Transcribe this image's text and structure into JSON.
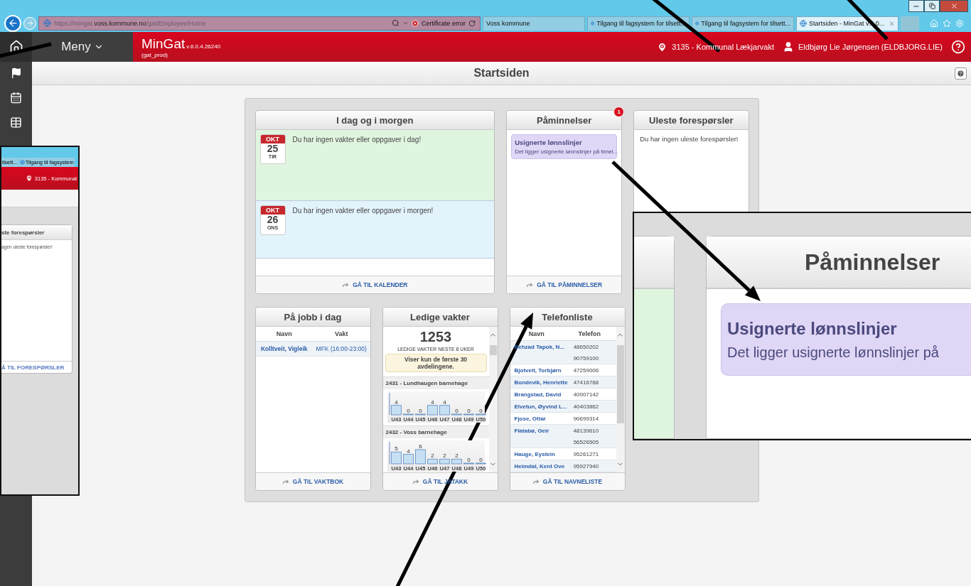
{
  "browser": {
    "address": [
      {
        "text": "https://mingat.",
        "highlighted": false
      },
      {
        "text": "voss.kommune.no",
        "highlighted": true
      },
      {
        "text": "/gat/Employee/Home",
        "highlighted": false
      }
    ],
    "certificate_error": "Certificate error",
    "tabs": [
      {
        "label": "Voss kommune",
        "selected": false,
        "icon": false
      },
      {
        "label": "Tilgang til fagsystem for tilsett...",
        "selected": false,
        "icon": true
      },
      {
        "label": "Tilgang til fagsystem for tilsett...",
        "selected": false,
        "icon": true
      },
      {
        "label": "Startsiden - MinGat v.6.0...",
        "selected": true,
        "icon": true
      }
    ]
  },
  "app_header": {
    "menu": "Meny",
    "product": "MinGat",
    "version": "v.6.0.4.26240",
    "environment": "(gat_prod)",
    "location": "3135 - Kommunal Lækjarvakt",
    "user": "Eldbjørg Lie Jørgensen (ELDBJORG.LIE)"
  },
  "page_title": "Startsiden",
  "today_tomorrow": {
    "title": "I dag og i morgen",
    "days": [
      {
        "month": "OKT",
        "day": "25",
        "weekday": "TIR",
        "message": "Du har ingen vakter eller oppgaver i dag!",
        "color": "#e0f5df"
      },
      {
        "month": "OKT",
        "day": "26",
        "weekday": "ONS",
        "message": "Du har ingen vakter eller oppgaver i morgen!",
        "color": "#e2f3fb"
      }
    ],
    "link": "GÅ TIL KALENDER"
  },
  "reminders": {
    "title": "Påminnelser",
    "badge": "1",
    "items": [
      {
        "title": "Usignerte lønnslinjer",
        "text": "Det ligger usignerte lønnslinjer på timel..."
      }
    ],
    "link": "GÅ TIL PÅMINNELSER"
  },
  "unread_requests": {
    "title": "Uleste forespørsler",
    "message": "Du har ingen uleste forespørsler!"
  },
  "at_work_today": {
    "title": "På jobb i dag",
    "columns": [
      "Navn",
      "Vakt"
    ],
    "rows": [
      {
        "name": "Kolltveit, Vigleik",
        "shift": "MFK (16:00-23:00)"
      }
    ],
    "link": "GÅ TIL VAKTBOK"
  },
  "free_shifts": {
    "title": "Ledige vakter",
    "count": "1253",
    "count_label": "LEDIGE VAKTER NESTE 8 UKER",
    "notice": "Viser kun de første 30 avdelingene.",
    "departments": [
      {
        "name": "2431 - Lundhaugen barnehage",
        "chart_data": {
          "type": "bar",
          "categories": [
            "U43",
            "U44",
            "U45",
            "U46",
            "U47",
            "U48",
            "U49",
            "U50"
          ],
          "values": [
            4,
            0,
            0,
            4,
            4,
            0,
            0,
            0
          ],
          "data_labels": true
        }
      },
      {
        "name": "2432 - Voss barnehage",
        "chart_data": {
          "type": "bar",
          "categories": [
            "U43",
            "U44",
            "U45",
            "U46",
            "U47",
            "U48",
            "U49",
            "U50"
          ],
          "values": [
            5,
            4,
            6,
            2,
            2,
            2,
            0,
            0
          ],
          "data_labels": true
        }
      }
    ],
    "link": "GÅ TIL JATAKK"
  },
  "phone_list": {
    "title": "Telefonliste",
    "columns": [
      "Navn",
      "Telefon"
    ],
    "rows": [
      {
        "name": "Behzad Tapok, N...",
        "phones": [
          "48650202",
          "90759100"
        ]
      },
      {
        "name": "Bjotveit, Torbjørn",
        "phones": [
          "47259006"
        ]
      },
      {
        "name": "Bondevik, Henriette",
        "phones": [
          "47416788"
        ]
      },
      {
        "name": "Brangstad, David",
        "phones": [
          "40007142"
        ]
      },
      {
        "name": "Elvetun, Øyvind L...",
        "phones": [
          "40403862"
        ]
      },
      {
        "name": "Fjose, Ottar",
        "phones": [
          "90699314"
        ]
      },
      {
        "name": "Flatabø, Geir",
        "phones": [
          "48139610",
          "56526505"
        ]
      },
      {
        "name": "Hauge, Eystein",
        "phones": [
          "95261271"
        ]
      },
      {
        "name": "Heimdal, Kent Ove",
        "phones": [
          "95927940"
        ]
      }
    ],
    "link": "GÅ TIL NAVNELISTE"
  },
  "left_inset": {
    "tabs": [
      "ilsett...",
      "Tilgang til fagsystem"
    ],
    "location": "3135 - Kommunal",
    "card_title": "ste forespørsler",
    "card_message": "agen uleste forespørsler!",
    "card_link": "Å TIL FORESPØRSLER"
  },
  "right_inset": {
    "card_title": "Påminnelser",
    "item_title": "Usignerte lønnslinjer",
    "item_text": "Det ligger usignerte lønnslinjer på"
  }
}
